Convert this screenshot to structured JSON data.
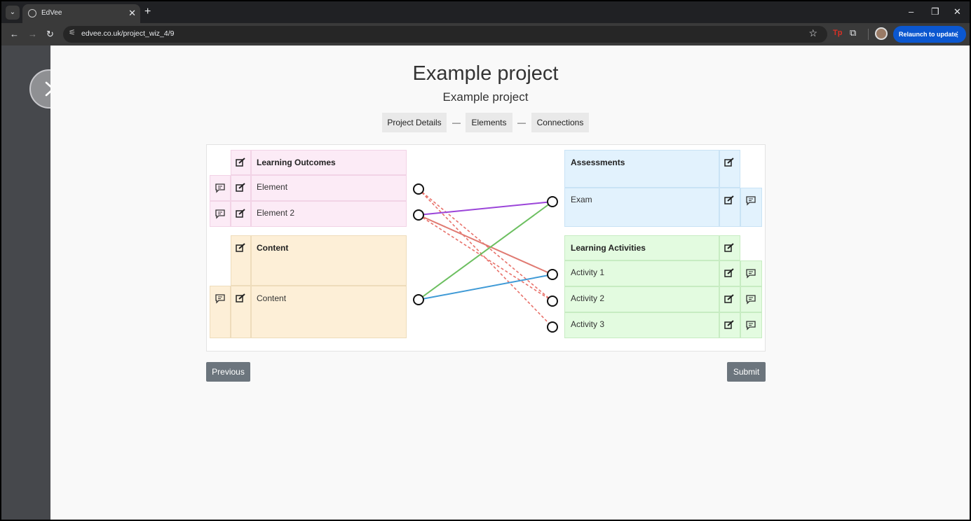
{
  "browser": {
    "tab_title": "EdVee",
    "url": "edvee.co.uk/project_wiz_4/9",
    "relaunch_label": "Relaunch to update",
    "ext_tp_label": "Tp"
  },
  "page": {
    "title": "Example project",
    "subtitle": "Example project"
  },
  "steps": {
    "items": [
      {
        "label": "Project Details"
      },
      {
        "label": "Elements"
      },
      {
        "label": "Connections"
      }
    ],
    "separator": "—"
  },
  "left": {
    "outcomes": {
      "header": "Learning Outcomes",
      "items": [
        {
          "label": "Element"
        },
        {
          "label": "Element 2"
        }
      ]
    },
    "content": {
      "header": "Content",
      "items": [
        {
          "label": "Content"
        }
      ]
    }
  },
  "right": {
    "assessments": {
      "header": "Assessments",
      "items": [
        {
          "label": "Exam"
        }
      ]
    },
    "activities": {
      "header": "Learning Activities",
      "items": [
        {
          "label": "Activity 1"
        },
        {
          "label": "Activity 2"
        },
        {
          "label": "Activity 3"
        }
      ]
    }
  },
  "connections": [
    {
      "from": "Element",
      "to": "Activity 2",
      "color": "#e8716a",
      "style": "dashed"
    },
    {
      "from": "Element",
      "to": "Activity 3",
      "color": "#e8716a",
      "style": "dashed"
    },
    {
      "from": "Element 2",
      "to": "Exam",
      "color": "#9b45d9",
      "style": "solid"
    },
    {
      "from": "Element 2",
      "to": "Activity 1",
      "color": "#e07a72",
      "style": "solid"
    },
    {
      "from": "Element 2",
      "to": "Activity 2",
      "color": "#e8716a",
      "style": "dashed"
    },
    {
      "from": "Content",
      "to": "Exam",
      "color": "#6cbf60",
      "style": "solid"
    },
    {
      "from": "Content",
      "to": "Activity 1",
      "color": "#3f9ad6",
      "style": "solid"
    }
  ],
  "buttons": {
    "previous": "Previous",
    "submit": "Submit"
  }
}
